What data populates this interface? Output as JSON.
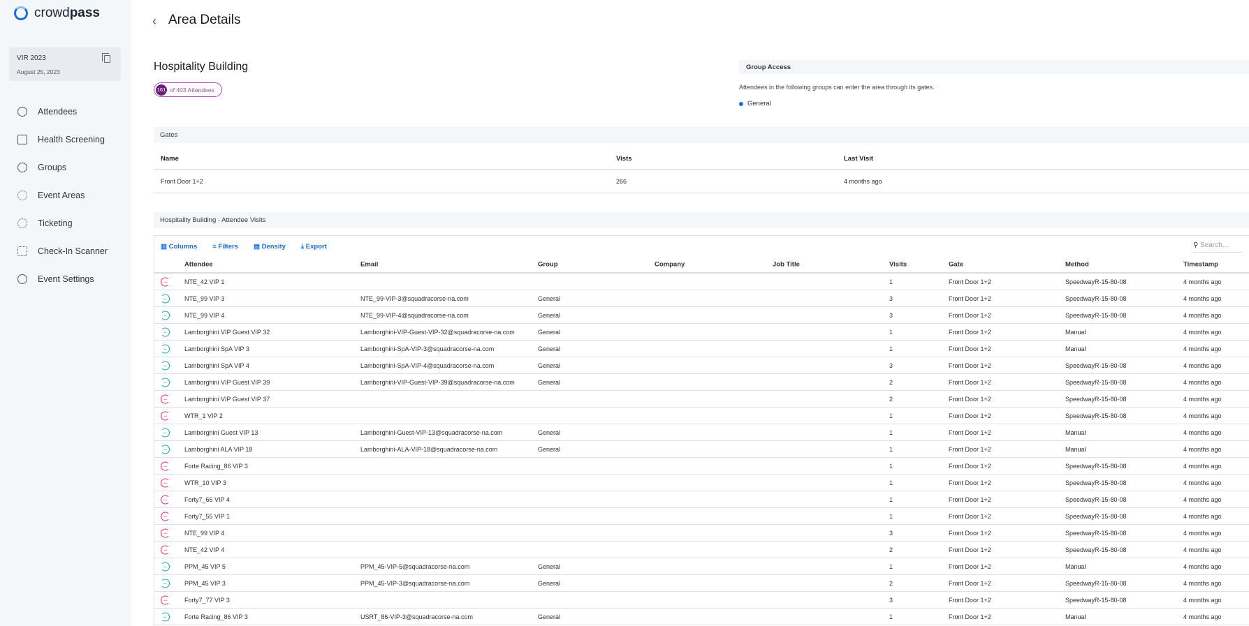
{
  "brand": {
    "name_light": "crowd",
    "name_bold": "pass",
    "accent": "#1a6fe0"
  },
  "event": {
    "name": "VIR 2023",
    "date": "August 25, 2023"
  },
  "nav": [
    "Attendees",
    "Health Screening",
    "Groups",
    "Event Areas",
    "Ticketing",
    "Check-In Scanner",
    "Event Settings"
  ],
  "page": {
    "back": "‹",
    "title": "Area Details",
    "area": "Hospitality Building",
    "count": "161",
    "count_label": "of 403 Attendees"
  },
  "group_access": {
    "title": "Group Access",
    "text": "Attendees in the following groups can enter the area through its gates.",
    "groups": [
      "General"
    ]
  },
  "gates": {
    "title": "Gates",
    "headers": [
      "Name",
      "Vists",
      "Last Visit"
    ],
    "rows": [
      [
        "Front Door 1+2",
        "266",
        "4 months ago"
      ]
    ]
  },
  "visits": {
    "title": "Hospitality Building - Attendee Visits",
    "toolbar": [
      "Columns",
      "Filters",
      "Density",
      "Export"
    ],
    "search_placeholder": "Search…",
    "headers": [
      "Attendee",
      "Email",
      "Group",
      "Company",
      "Job Title",
      "Visits",
      "Gate",
      "Method",
      "Timestamp"
    ],
    "rows": [
      {
        "dir": "out",
        "a": "NTE_42 VIP 1",
        "e": "",
        "g": "",
        "v": "1",
        "gate": "Front Door 1+2",
        "m": "SpeedwayR-15-80-08",
        "t": "4 months ago"
      },
      {
        "dir": "in",
        "a": "NTE_99 VIP 3",
        "e": "NTE_99-VIP-3@squadracorse-na.com",
        "g": "General",
        "v": "3",
        "gate": "Front Door 1+2",
        "m": "SpeedwayR-15-80-08",
        "t": "4 months ago"
      },
      {
        "dir": "in",
        "a": "NTE_99 VIP 4",
        "e": "NTE_99-VIP-4@squadracorse-na.com",
        "g": "General",
        "v": "3",
        "gate": "Front Door 1+2",
        "m": "SpeedwayR-15-80-08",
        "t": "4 months ago"
      },
      {
        "dir": "in",
        "a": "Lamborghini VIP Guest VIP 32",
        "e": "Lamborghini-VIP-Guest-VIP-32@squadracorse-na.com",
        "g": "General",
        "v": "1",
        "gate": "Front Door 1+2",
        "m": "Manual",
        "t": "4 months ago"
      },
      {
        "dir": "in",
        "a": "Lamborghini SpA VIP 3",
        "e": "Lamborghini-SpA-VIP-3@squadracorse-na.com",
        "g": "General",
        "v": "1",
        "gate": "Front Door 1+2",
        "m": "Manual",
        "t": "4 months ago"
      },
      {
        "dir": "in",
        "a": "Lamborghini SpA VIP 4",
        "e": "Lamborghini-SpA-VIP-4@squadracorse-na.com",
        "g": "General",
        "v": "3",
        "gate": "Front Door 1+2",
        "m": "SpeedwayR-15-80-08",
        "t": "4 months ago"
      },
      {
        "dir": "in",
        "a": "Lamborghini VIP Guest VIP 39",
        "e": "Lamborghini-VIP-Guest-VIP-39@squadracorse-na.com",
        "g": "General",
        "v": "2",
        "gate": "Front Door 1+2",
        "m": "SpeedwayR-15-80-08",
        "t": "4 months ago"
      },
      {
        "dir": "out",
        "a": "Lamborghini VIP Guest VIP 37",
        "e": "",
        "g": "",
        "v": "2",
        "gate": "Front Door 1+2",
        "m": "SpeedwayR-15-80-08",
        "t": "4 months ago"
      },
      {
        "dir": "out",
        "a": "WTR_1 VIP 2",
        "e": "",
        "g": "",
        "v": "1",
        "gate": "Front Door 1+2",
        "m": "SpeedwayR-15-80-08",
        "t": "4 months ago"
      },
      {
        "dir": "in",
        "a": "Lamborghini Guest VIP 13",
        "e": "Lamborghini-Guest-VIP-13@squadracorse-na.com",
        "g": "General",
        "v": "1",
        "gate": "Front Door 1+2",
        "m": "Manual",
        "t": "4 months ago"
      },
      {
        "dir": "in",
        "a": "Lamborghini ALA VIP 18",
        "e": "Lamborghini-ALA-VIP-18@squadracorse-na.com",
        "g": "General",
        "v": "1",
        "gate": "Front Door 1+2",
        "m": "Manual",
        "t": "4 months ago"
      },
      {
        "dir": "out",
        "a": "Forte Racing_86 VIP 3",
        "e": "",
        "g": "",
        "v": "1",
        "gate": "Front Door 1+2",
        "m": "SpeedwayR-15-80-08",
        "t": "4 months ago"
      },
      {
        "dir": "out",
        "a": "WTR_10 VIP 3",
        "e": "",
        "g": "",
        "v": "1",
        "gate": "Front Door 1+2",
        "m": "SpeedwayR-15-80-08",
        "t": "4 months ago"
      },
      {
        "dir": "out",
        "a": "Forty7_66 VIP 4",
        "e": "",
        "g": "",
        "v": "1",
        "gate": "Front Door 1+2",
        "m": "SpeedwayR-15-80-08",
        "t": "4 months ago"
      },
      {
        "dir": "out",
        "a": "Forty7_55 VIP 1",
        "e": "",
        "g": "",
        "v": "1",
        "gate": "Front Door 1+2",
        "m": "SpeedwayR-15-80-08",
        "t": "4 months ago"
      },
      {
        "dir": "out",
        "a": "NTE_99 VIP 4",
        "e": "",
        "g": "",
        "v": "3",
        "gate": "Front Door 1+2",
        "m": "SpeedwayR-15-80-08",
        "t": "4 months ago"
      },
      {
        "dir": "out",
        "a": "NTE_42 VIP 4",
        "e": "",
        "g": "",
        "v": "2",
        "gate": "Front Door 1+2",
        "m": "SpeedwayR-15-80-08",
        "t": "4 months ago"
      },
      {
        "dir": "in",
        "a": "PPM_45 VIP 5",
        "e": "PPM_45-VIP-5@squadracorse-na.com",
        "g": "General",
        "v": "1",
        "gate": "Front Door 1+2",
        "m": "Manual",
        "t": "4 months ago"
      },
      {
        "dir": "in",
        "a": "PPM_45 VIP 3",
        "e": "PPM_45-VIP-3@squadracorse-na.com",
        "g": "General",
        "v": "2",
        "gate": "Front Door 1+2",
        "m": "SpeedwayR-15-80-08",
        "t": "4 months ago"
      },
      {
        "dir": "out",
        "a": "Forty7_77 VIP 3",
        "e": "",
        "g": "",
        "v": "3",
        "gate": "Front Door 1+2",
        "m": "SpeedwayR-15-80-08",
        "t": "4 months ago"
      },
      {
        "dir": "in",
        "a": "Forte Racing_86 VIP 3",
        "e": "USRT_86-VIP-3@squadracorse-na.com",
        "g": "General",
        "v": "1",
        "gate": "Front Door 1+2",
        "m": "Manual",
        "t": "4 months ago"
      }
    ]
  }
}
